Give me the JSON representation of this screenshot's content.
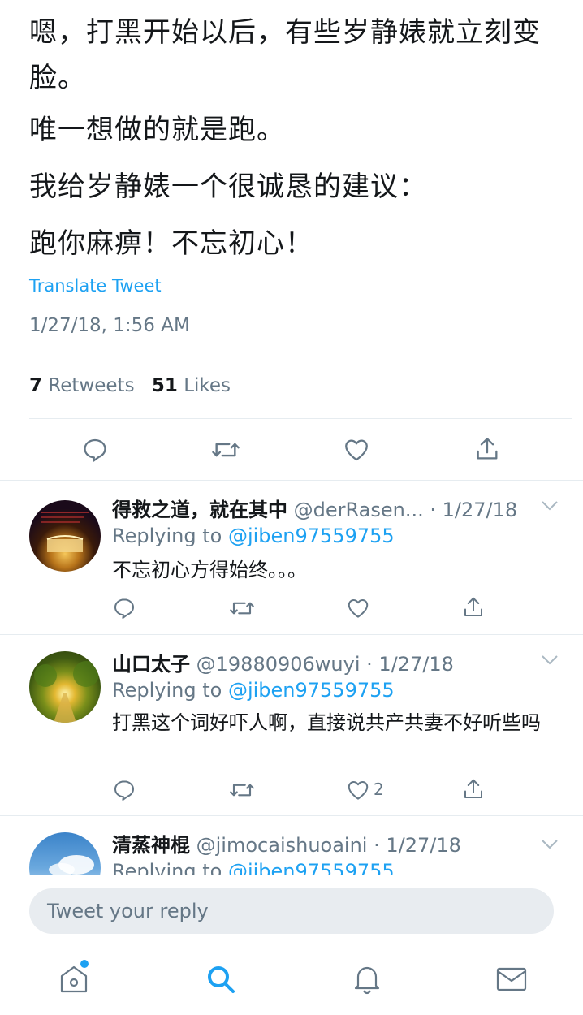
{
  "tweet": {
    "paragraphs": [
      "嗯，打黑开始以后，有些岁静婊就立刻变脸。",
      "唯一想做的就是跑。",
      "我给岁静婊一个很诚恳的建议：",
      "跑你麻痹！不忘初心！"
    ],
    "translate_label": "Translate Tweet",
    "timestamp": "1/27/18, 1:56 AM",
    "retweets_count": "7",
    "retweets_label": "Retweets",
    "likes_count": "51",
    "likes_label": "Likes"
  },
  "replies": [
    {
      "name": "得救之道，就在其中",
      "handle": "@derRasen...",
      "date": "· 1/27/18",
      "replying_label": "Replying to",
      "replying_handle": "@jiben97559755",
      "text": "不忘初心方得始终。。。",
      "like_count": ""
    },
    {
      "name": "山口太子",
      "handle": "@19880906wuyi",
      "date": "· 1/27/18",
      "replying_label": "Replying to",
      "replying_handle": "@jiben97559755",
      "text": "打黑这个词好吓人啊，直接说共产共妻不好听些吗",
      "like_count": "2"
    },
    {
      "name": "清蒸神棍",
      "handle": "@jimocaishuoaini",
      "date": "· 1/27/18",
      "replying_label": "Replying to",
      "replying_handle": "@jiben97559755"
    }
  ],
  "compose": {
    "placeholder": "Tweet your reply"
  },
  "colors": {
    "accent": "#1da1f2",
    "muted": "#657786",
    "text": "#14171a",
    "divider": "#e6ecf0"
  },
  "icons": [
    "reply-icon",
    "retweet-icon",
    "like-icon",
    "share-icon",
    "chevron-down-icon",
    "home-icon",
    "search-icon",
    "notifications-icon",
    "messages-icon"
  ]
}
